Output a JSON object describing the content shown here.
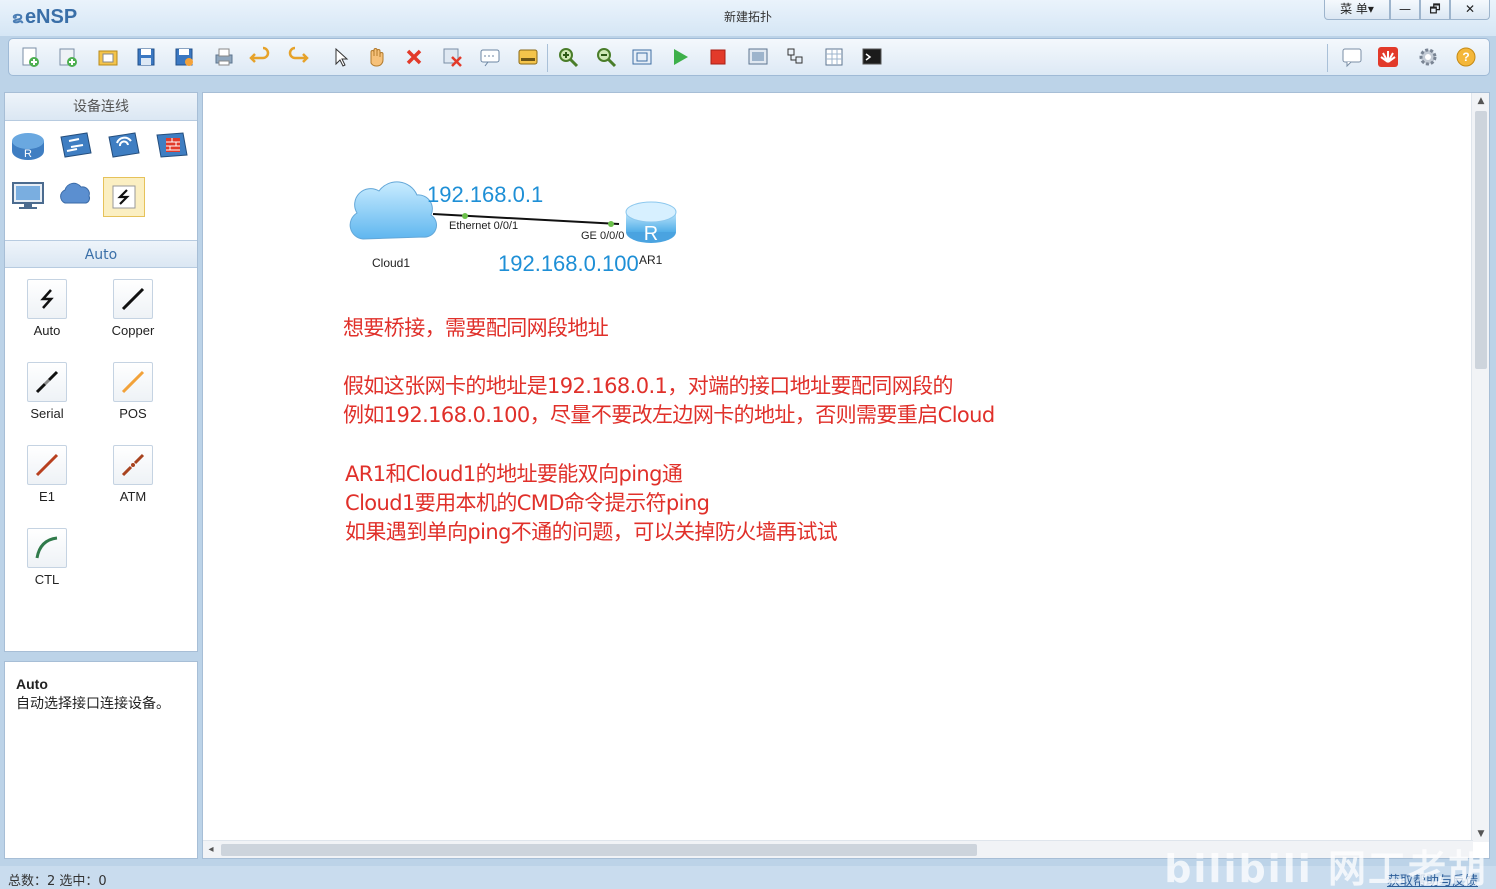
{
  "app": {
    "logo_text": "eNSP",
    "window_title": "新建拓扑"
  },
  "window_controls": {
    "menu": "菜 单▾",
    "minimize": "—",
    "maximize": "🗗",
    "close": "✕"
  },
  "toolbar": {
    "left_icons": [
      "new-topology-icon",
      "new-lab-icon",
      "open-icon",
      "save-icon",
      "save-as-icon",
      "print-icon",
      "undo-icon",
      "redo-icon",
      "select-icon",
      "pan-hand-icon",
      "delete-icon",
      "delete-connection-icon",
      "text-icon",
      "palette-icon",
      "zoom-in-icon",
      "zoom-out-icon",
      "fit-view-icon",
      "start-device-icon",
      "stop-device-icon",
      "capture-data-icon",
      "display-ports-icon",
      "grid-icon",
      "cli-icon"
    ],
    "right_icons": [
      "chat-icon",
      "huawei-icon",
      "settings-icon",
      "help-icon"
    ]
  },
  "left_panel": {
    "devices_header": "设备连线",
    "devices": [
      "router-icon",
      "switch-icon",
      "wlan-icon",
      "firewall-icon",
      "pc-icon",
      "cloud-icon",
      "connection-icon"
    ],
    "cables_header": "Auto",
    "cables": [
      {
        "label": "Auto",
        "color": "#111111"
      },
      {
        "label": "Copper",
        "color": "#111111"
      },
      {
        "label": "Serial",
        "color": "#111111"
      },
      {
        "label": "POS",
        "color": "#f2a23a"
      },
      {
        "label": "E1",
        "color": "#b8401f"
      },
      {
        "label": "ATM",
        "color": "#a8431f"
      },
      {
        "label": "CTL",
        "color": "#2f7a4a"
      }
    ]
  },
  "info_panel": {
    "title": "Auto",
    "description": "自动选择接口连接设备。"
  },
  "topology": {
    "cloud_ip": "192.168.0.1",
    "router_ip": "192.168.0.100",
    "cloud_port": "Ethernet 0/0/1",
    "router_port": "GE 0/0/0",
    "cloud_name": "Cloud1",
    "router_name": "AR1",
    "link_color": "#111111",
    "ip_color": "#1e8fd6"
  },
  "notes": [
    "想要桥接，需要配同网段地址",
    "假如这张网卡的地址是192.168.0.1，对端的接口地址要配同网段的",
    "例如192.168.0.100，尽量不要改左边网卡的地址，否则需要重启Cloud",
    "AR1和Cloud1的地址要能双向ping通",
    "Cloud1要用本机的CMD命令提示符ping",
    "如果遇到单向ping不通的问题，可以关掉防火墙再试试"
  ],
  "notes_color": "#e0302a",
  "status": {
    "text": "总数：2 选中：0",
    "link": "获取帮助与反馈"
  },
  "watermark": "bilibili 网工老胡"
}
